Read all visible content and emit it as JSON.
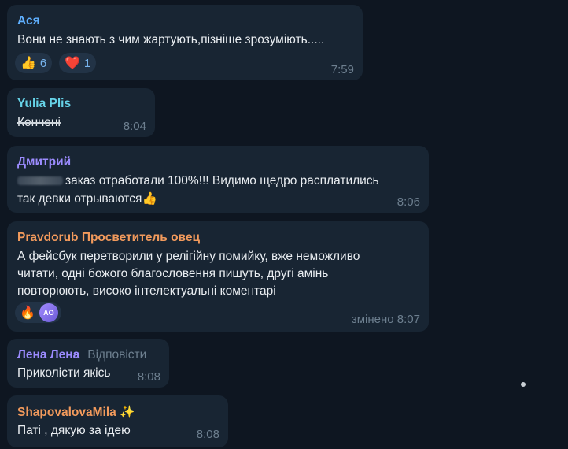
{
  "colors": {
    "background": "#0e1621",
    "bubble": "#182533",
    "author_asya": "#5fb0ff",
    "author_yulia": "#66d3e8",
    "author_dmitriy": "#9c8cff",
    "author_pravdorub": "#f29a5c",
    "author_lena": "#9c8cff",
    "author_shapovalova": "#f29a5c",
    "time": "#6d7f8f"
  },
  "messages": [
    {
      "author": "Ася",
      "text": "Вони не знають з чим жартують,пізніше зрозуміють.....",
      "time": "7:59",
      "reactions": [
        {
          "emoji": "👍",
          "count": "6"
        },
        {
          "emoji": "❤️",
          "count": "1"
        }
      ]
    },
    {
      "author": "Yulia Plis",
      "text": "Кончені",
      "time": "8:04"
    },
    {
      "author": "Дмитрий",
      "text_line1": "заказ отработали 100%!!! Видимо щедро расплатились",
      "text_line2": "так девки отрываются👍",
      "time": "8:06"
    },
    {
      "author": "Pravdorub Просветитель овец",
      "text_line1": "А фейсбук перетворили у релігійну  помийку, вже неможливо",
      "text_line2": "читати, одні божого благословення пишуть, другі амінь",
      "text_line3": "повторюють, високо інтелектуальні коментарі",
      "edited_time": "змінено 8:07",
      "reaction_emoji": "🔥",
      "reaction_avatar": "AO"
    },
    {
      "author": "Лена Лена",
      "reply_label": "Відповісти",
      "text": "Приколісти якісь",
      "time": "8:08"
    },
    {
      "author": "ShapovalovaMila ✨",
      "text": "Паті , дякую за ідею",
      "time": "8:08"
    }
  ]
}
